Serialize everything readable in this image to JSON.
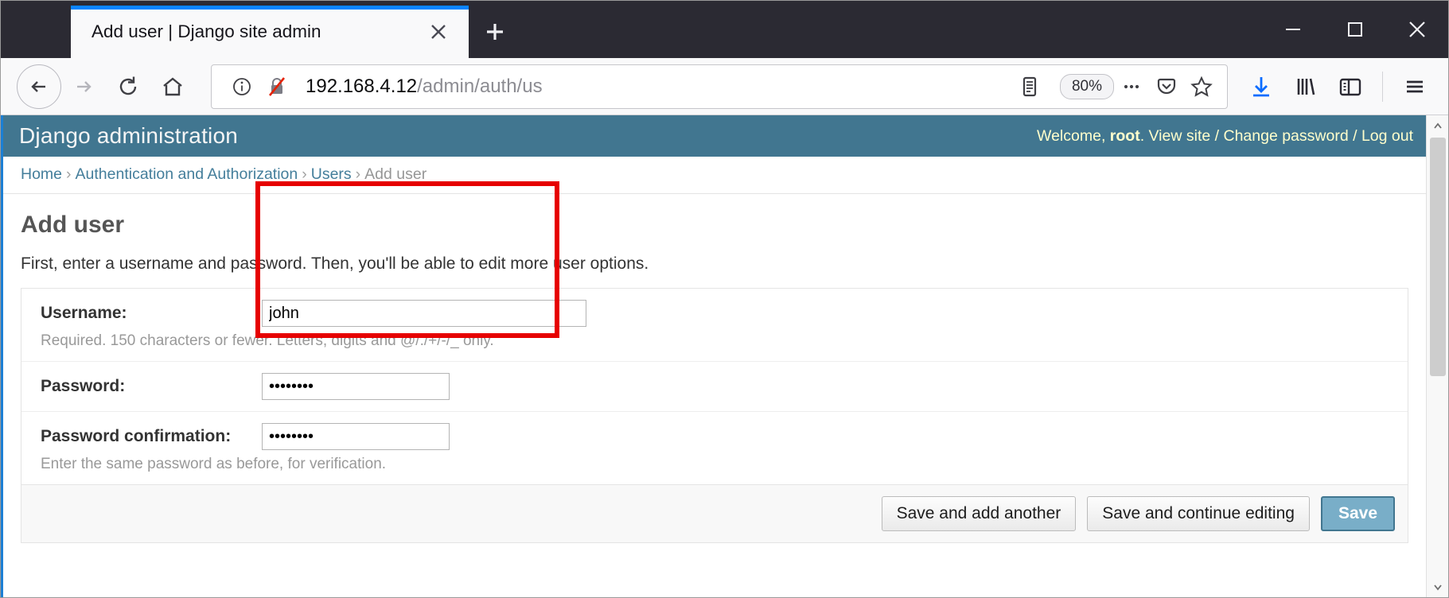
{
  "browser": {
    "tab": {
      "title": "Add user | Django site admin",
      "close_icon": "close-icon"
    },
    "new_tab_label": "+",
    "window_controls": {
      "minimize": "minimize-icon",
      "maximize": "maximize-icon",
      "close": "close-icon"
    },
    "toolbar": {
      "back": "back-arrow-icon",
      "forward": "forward-arrow-icon",
      "reload": "reload-icon",
      "home": "home-icon",
      "identity": "info-icon",
      "security": "crossed-out-lock-icon",
      "reader": "reader-mode-icon",
      "zoom_level": "80%",
      "page_actions": "ellipsis-icon",
      "pocket": "pocket-icon",
      "bookmark": "star-icon",
      "downloads": "download-arrow-icon",
      "library": "library-icon",
      "sidebar": "sidebar-icon",
      "menu": "hamburger-menu-icon"
    },
    "url": {
      "host": "192.168.4.12",
      "path": "/admin/auth/us"
    }
  },
  "django": {
    "branding": "Django administration",
    "user_tools": {
      "welcome_prefix": "Welcome, ",
      "username": "root",
      "separator_after_user": ". ",
      "view_site": "View site",
      "slash1": " / ",
      "change_password": "Change password",
      "slash2": " / ",
      "log_out": "Log out"
    },
    "breadcrumbs": [
      {
        "label": "Home",
        "link": true
      },
      {
        "label": "Authentication and Authorization",
        "link": true
      },
      {
        "label": "Users",
        "link": true
      },
      {
        "label": "Add user",
        "link": false
      }
    ],
    "breadcrumb_separator": "›",
    "page_title": "Add user",
    "form_intro": "First, enter a username and password. Then, you'll be able to edit more user options.",
    "fields": {
      "username": {
        "label": "Username:",
        "value": "john",
        "help": "Required. 150 characters or fewer. Letters, digits and @/./+/-/_ only."
      },
      "password": {
        "label": "Password:",
        "value": "••••••••",
        "help": ""
      },
      "password_confirmation": {
        "label": "Password confirmation:",
        "value": "••••••••",
        "help": "Enter the same password as before, for verification."
      }
    },
    "buttons": {
      "save_and_add_another": "Save and add another",
      "save_and_continue": "Save and continue editing",
      "save": "Save"
    },
    "colors": {
      "header_bg": "#417690",
      "link": "#447e9b",
      "default_button": "#79aec8",
      "annotation": "#e60000"
    }
  }
}
